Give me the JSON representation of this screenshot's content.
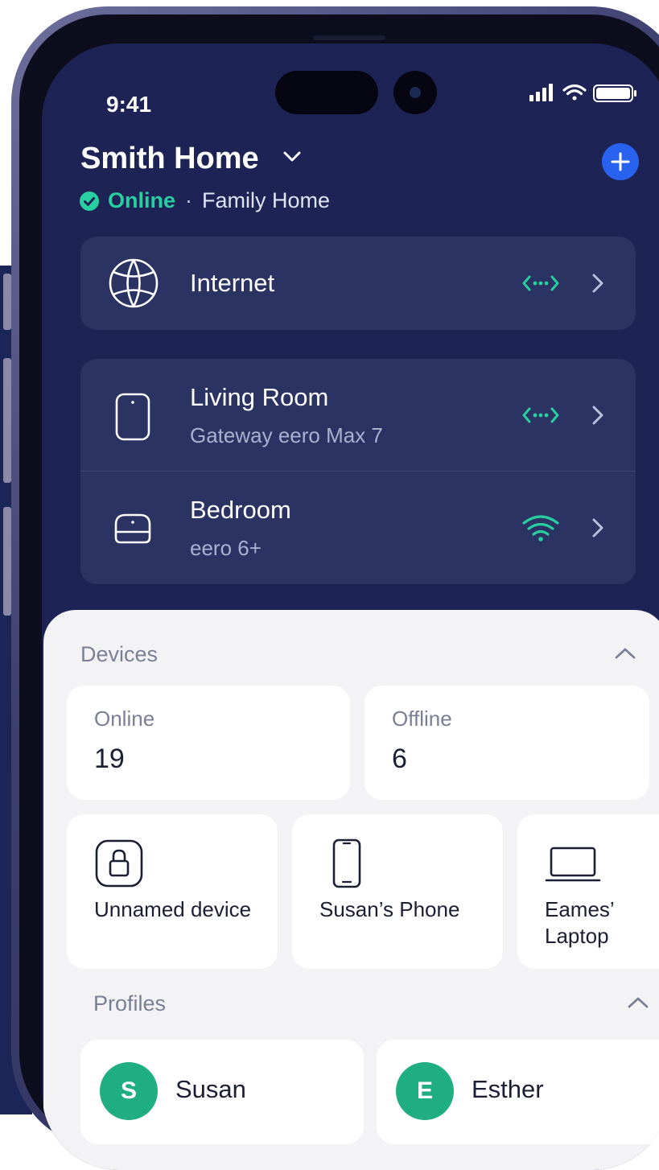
{
  "status_bar": {
    "time": "9:41"
  },
  "header": {
    "network_name": "Smith Home",
    "status": "Online",
    "separator": "·",
    "network_type": "Family Home"
  },
  "internet": {
    "label": "Internet",
    "status_icon": "connection-dots-icon"
  },
  "nodes": [
    {
      "name": "Living Room",
      "model": "Gateway eero Max 7",
      "status_icon": "connection-dots-icon"
    },
    {
      "name": "Bedroom",
      "model": "eero 6+",
      "status_icon": "wifi-signal-icon"
    }
  ],
  "devices": {
    "title": "Devices",
    "online_label": "Online",
    "online_count": "19",
    "offline_label": "Offline",
    "offline_count": "6",
    "items": [
      {
        "name": "Unnamed device",
        "icon": "lock-icon"
      },
      {
        "name": "Susan’s Phone",
        "icon": "phone-icon"
      },
      {
        "name": "Eames’ Laptop",
        "icon": "laptop-icon"
      }
    ]
  },
  "profiles": {
    "title": "Profiles",
    "items": [
      {
        "initial": "S",
        "name": "Susan"
      },
      {
        "initial": "E",
        "name": "Esther"
      }
    ]
  },
  "colors": {
    "screen_bg": "#1d2455",
    "card_bg": "#2b3362",
    "accent_green": "#28cfa1",
    "add_button": "#2a62f0",
    "avatar": "#1fae80"
  }
}
